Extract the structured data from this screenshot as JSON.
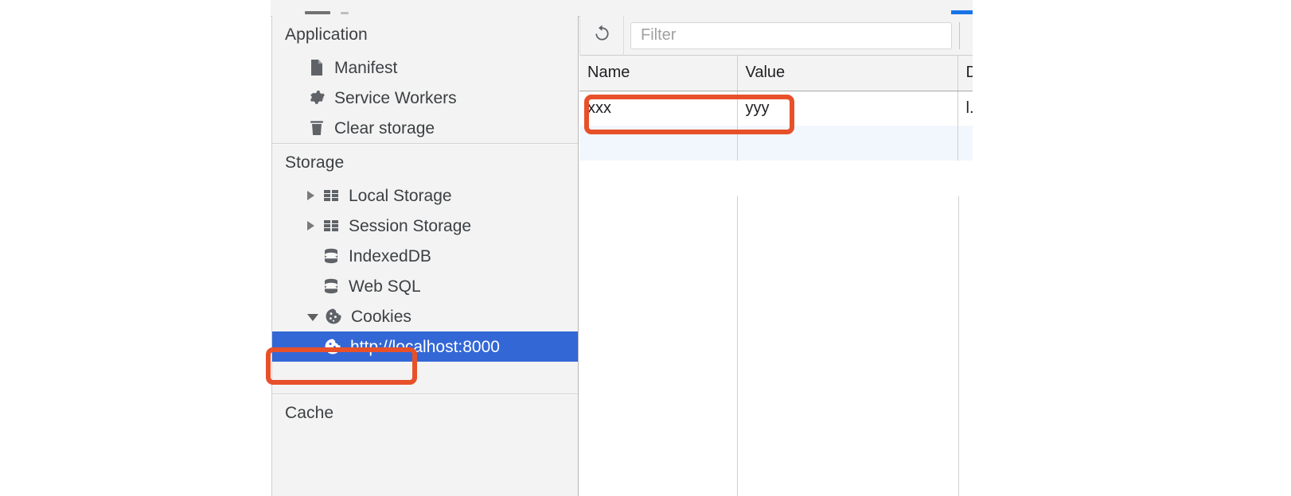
{
  "panel": {
    "name": "Chrome DevTools Application panel"
  },
  "sidebar": {
    "sections": [
      {
        "title": "Application",
        "items": [
          {
            "label": "Manifest",
            "icon": "document-icon",
            "indent": 1,
            "twisty": "none",
            "selected": false
          },
          {
            "label": "Service Workers",
            "icon": "gear-icon",
            "indent": 1,
            "twisty": "none",
            "selected": false
          },
          {
            "label": "Clear storage",
            "icon": "trash-icon",
            "indent": 1,
            "twisty": "none",
            "selected": false
          }
        ]
      },
      {
        "title": "Storage",
        "items": [
          {
            "label": "Local Storage",
            "icon": "table-icon",
            "indent": 1,
            "twisty": "collapsed",
            "selected": false
          },
          {
            "label": "Session Storage",
            "icon": "table-icon",
            "indent": 1,
            "twisty": "collapsed",
            "selected": false
          },
          {
            "label": "IndexedDB",
            "icon": "database-icon",
            "indent": 1,
            "twisty": "none",
            "selected": false
          },
          {
            "label": "Web SQL",
            "icon": "database-icon",
            "indent": 1,
            "twisty": "none",
            "selected": false
          },
          {
            "label": "Cookies",
            "icon": "cookie-icon",
            "indent": 1,
            "twisty": "expanded",
            "selected": false
          },
          {
            "label": "http://localhost:8000",
            "icon": "cookie-icon",
            "indent": 2,
            "twisty": "none",
            "selected": true
          }
        ]
      },
      {
        "title": "Cache",
        "items": []
      }
    ]
  },
  "toolbar": {
    "refresh_icon": "refresh-icon",
    "filter_placeholder": "Filter",
    "filter_value": ""
  },
  "cookies_table": {
    "columns": [
      "Name",
      "Value",
      "D"
    ],
    "rows": [
      {
        "name": "xxx",
        "value": "yyy",
        "domain": "l."
      }
    ],
    "blank_rows": 2
  },
  "annotations": [
    {
      "name": "cookies-highlight",
      "target": "Cookies",
      "color": "#e8502a"
    },
    {
      "name": "cookie-row-highlight",
      "target": "xxx / yyy row",
      "color": "#e8502a"
    }
  ],
  "colors": {
    "selection_blue": "#3367d6",
    "annotation_orange": "#e8502a",
    "sidebar_bg": "#f3f3f3",
    "row_stripe": "#f2f7fd",
    "tab_accent": "#1a73e8"
  }
}
